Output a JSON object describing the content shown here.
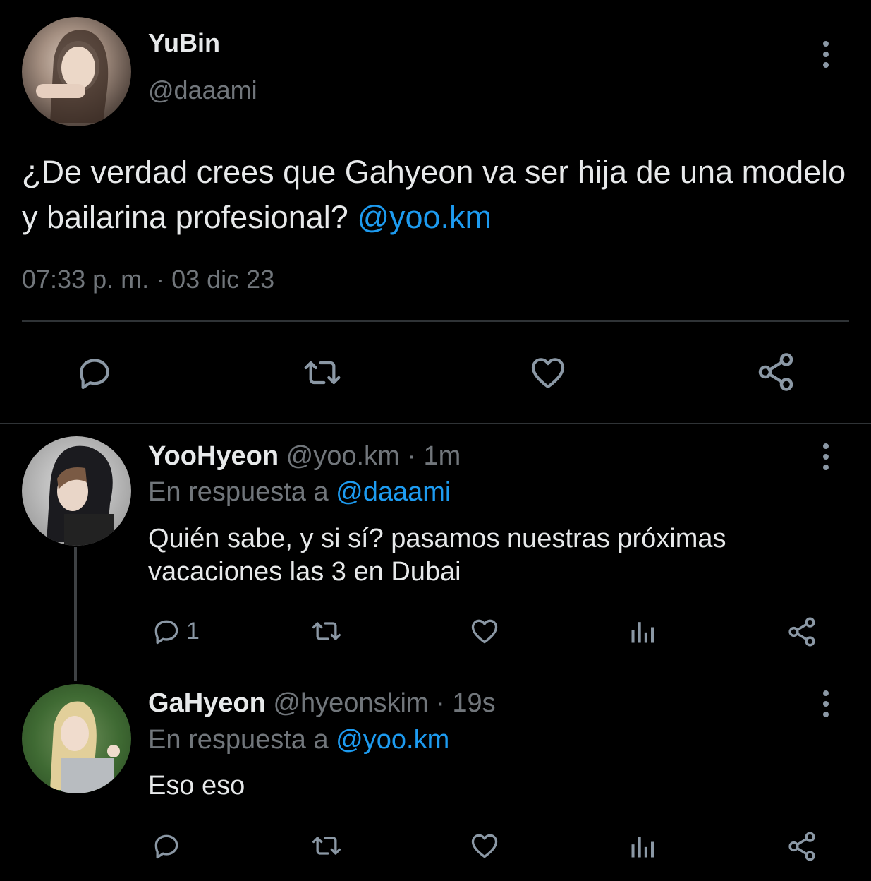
{
  "main_tweet": {
    "display_name": "YuBin",
    "handle": "@daaami",
    "text": "¿De verdad crees que Gahyeon va ser hija de una modelo y bailarina profesional?",
    "mention": "@yoo.km",
    "timestamp": "07:33 p. m. · 03 dic 23",
    "actions": [
      "reply-icon",
      "retweet-icon",
      "like-icon",
      "share-icon"
    ]
  },
  "replies": [
    {
      "display_name": "YooHyeon",
      "handle": "@yoo.km",
      "time": " · 1m",
      "reply_prefix": "En respuesta a ",
      "reply_to": "@daaami",
      "text_line1": "Quién sabe, y si sí? pasamos nuestras próximas",
      "text_line2": "vacaciones las 3 en Dubai",
      "reply_count": "1"
    },
    {
      "display_name": "GaHyeon",
      "handle": "@hyeonskim",
      "time": " · 19s",
      "reply_prefix": "En respuesta a ",
      "reply_to": "@yoo.km",
      "text_line1": "Eso eso",
      "reply_count": ""
    }
  ],
  "colors": {
    "background": "#000000",
    "text": "#e7e9ea",
    "muted": "#71767b",
    "link": "#1d9bf0",
    "icon": "#8b98a5",
    "divider": "#2f3336"
  }
}
